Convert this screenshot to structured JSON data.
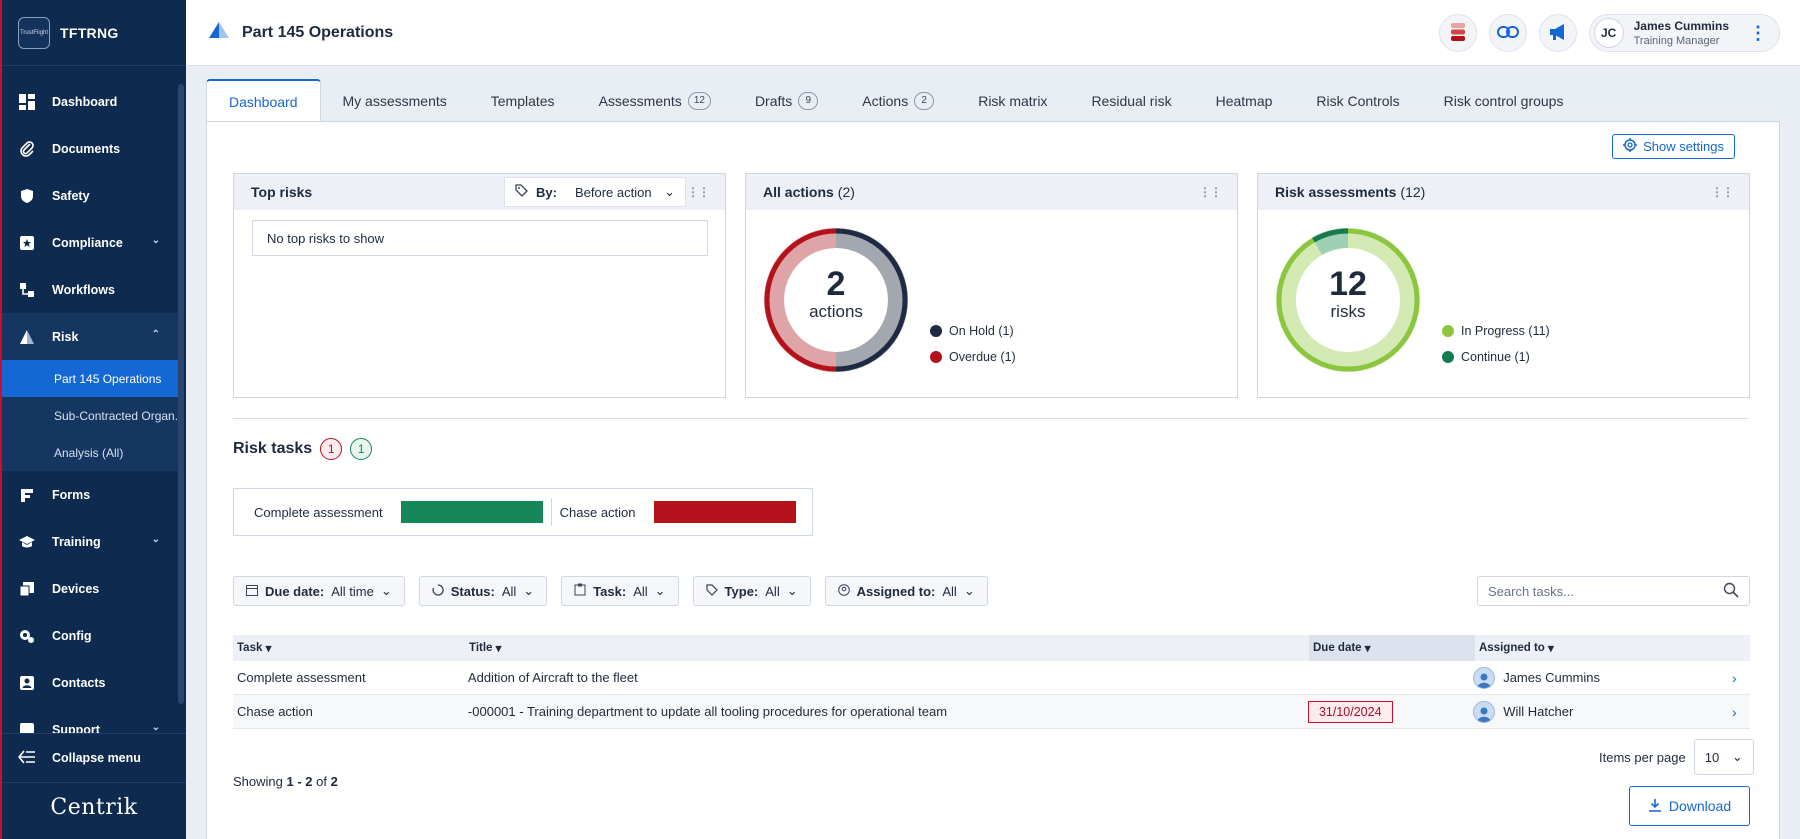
{
  "brand": {
    "name": "TFTRNG",
    "logo_text": "TrustFlight"
  },
  "sidebar": {
    "items": [
      {
        "label": "Dashboard",
        "icon": "dashboard-icon",
        "has_chevron": false
      },
      {
        "label": "Documents",
        "icon": "paperclip-icon",
        "has_chevron": false
      },
      {
        "label": "Safety",
        "icon": "shield-icon",
        "has_chevron": false
      },
      {
        "label": "Compliance",
        "icon": "star-badge-icon",
        "has_chevron": true
      },
      {
        "label": "Workflows",
        "icon": "workflow-icon",
        "has_chevron": false
      },
      {
        "label": "Risk",
        "icon": "risk-icon",
        "has_chevron": true,
        "expanded": true
      },
      {
        "label": "Forms",
        "icon": "form-icon",
        "has_chevron": false
      },
      {
        "label": "Training",
        "icon": "graduation-cap-icon",
        "has_chevron": true
      },
      {
        "label": "Devices",
        "icon": "devices-icon",
        "has_chevron": false
      },
      {
        "label": "Config",
        "icon": "config-icon",
        "has_chevron": false
      },
      {
        "label": "Contacts",
        "icon": "contacts-icon",
        "has_chevron": false
      },
      {
        "label": "Support",
        "icon": "support-icon",
        "has_chevron": true
      }
    ],
    "risk_sub": [
      {
        "label": "Part 145 Operations",
        "active": true
      },
      {
        "label": "Sub-Contracted Organ...",
        "active": false
      },
      {
        "label": "Analysis (All)",
        "active": false
      }
    ],
    "collapse_label": "Collapse menu",
    "footer_logo": "Centrik"
  },
  "header": {
    "title": "Part 145 Operations",
    "user": {
      "initials": "JC",
      "name": "James Cummins",
      "role": "Training Manager"
    }
  },
  "tabs": [
    {
      "label": "Dashboard",
      "count": null,
      "active": true
    },
    {
      "label": "My assessments",
      "count": null
    },
    {
      "label": "Templates",
      "count": null
    },
    {
      "label": "Assessments",
      "count": "12"
    },
    {
      "label": "Drafts",
      "count": "9"
    },
    {
      "label": "Actions",
      "count": "2"
    },
    {
      "label": "Risk matrix",
      "count": null
    },
    {
      "label": "Residual risk",
      "count": null
    },
    {
      "label": "Heatmap",
      "count": null
    },
    {
      "label": "Risk Controls",
      "count": null
    },
    {
      "label": "Risk control groups",
      "count": null
    }
  ],
  "dashboard": {
    "show_settings": "Show settings",
    "top_risks": {
      "title": "Top risks",
      "by_label": "By:",
      "by_value": "Before action",
      "empty": "No top risks to show"
    },
    "all_actions": {
      "title": "All actions",
      "count": "(2)",
      "total": "2",
      "unit": "actions",
      "legend": [
        {
          "label": "On Hold (1)",
          "color": "#1f2a44",
          "value": 1
        },
        {
          "label": "Overdue (1)",
          "color": "#b3121b",
          "value": 1
        }
      ]
    },
    "risk_assessments": {
      "title": "Risk assessments",
      "count": "(12)",
      "total": "12",
      "unit": "risks",
      "legend": [
        {
          "label": "In Progress (11)",
          "color": "#8cc63f",
          "value": 11
        },
        {
          "label": "Continue (1)",
          "color": "#157a4f",
          "value": 1
        }
      ]
    },
    "risk_tasks": {
      "title": "Risk tasks",
      "badge_red": "1",
      "badge_green": "1",
      "complete_label": "Complete assessment",
      "chase_label": "Chase action",
      "complete_color": "#15865a",
      "chase_color": "#b3121b"
    }
  },
  "filters": [
    {
      "label": "Due date:",
      "value": "All time",
      "icon": "calendar-icon"
    },
    {
      "label": "Status:",
      "value": "All",
      "icon": "status-circle-icon"
    },
    {
      "label": "Task:",
      "value": "All",
      "icon": "clipboard-icon"
    },
    {
      "label": "Type:",
      "value": "All",
      "icon": "tag-icon"
    },
    {
      "label": "Assigned to:",
      "value": "All",
      "icon": "user-circle-icon"
    }
  ],
  "search": {
    "placeholder": "Search tasks..."
  },
  "table": {
    "columns": [
      "Task",
      "Title",
      "Due date",
      "Assigned to"
    ],
    "rows": [
      {
        "task": "Complete assessment",
        "title": "Addition of Aircraft to the fleet",
        "due": "",
        "assigned": "James Cummins"
      },
      {
        "task": "Chase action",
        "title": "-000001 - Training department to update all tooling procedures for operational team",
        "due": "31/10/2024",
        "assigned": "Will Hatcher"
      }
    ]
  },
  "pagination": {
    "showing_prefix": "Showing",
    "range": "1 - 2",
    "of": "of",
    "total": "2",
    "items_per_page_label": "Items per page",
    "items_per_page": "10"
  },
  "download_label": "Download"
}
